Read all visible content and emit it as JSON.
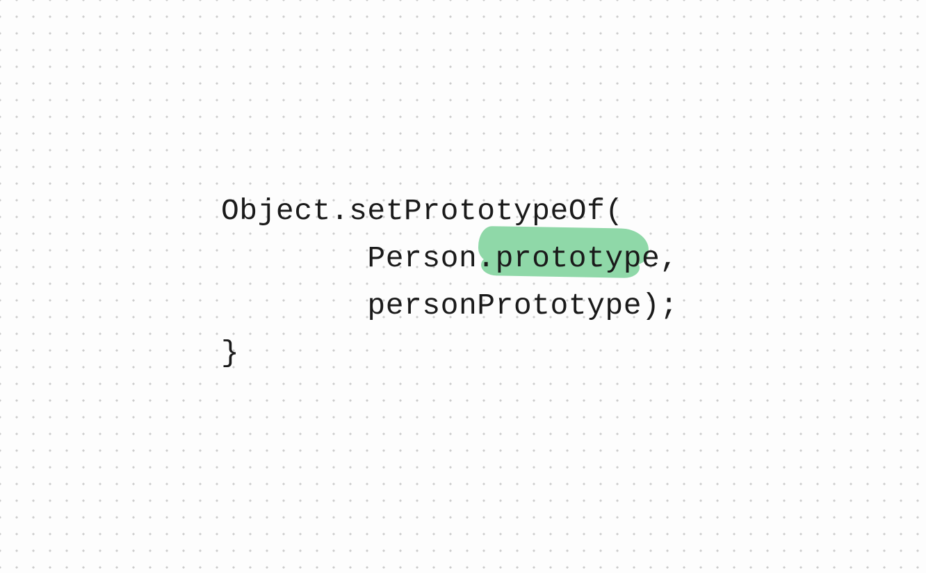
{
  "code": {
    "line1": "Object.setPrototypeOf(",
    "line2": "        Person.prototype,",
    "line3": "        personPrototype);",
    "line4": "}"
  },
  "highlight": {
    "text": "prototype",
    "color": "#8fd8a8"
  }
}
